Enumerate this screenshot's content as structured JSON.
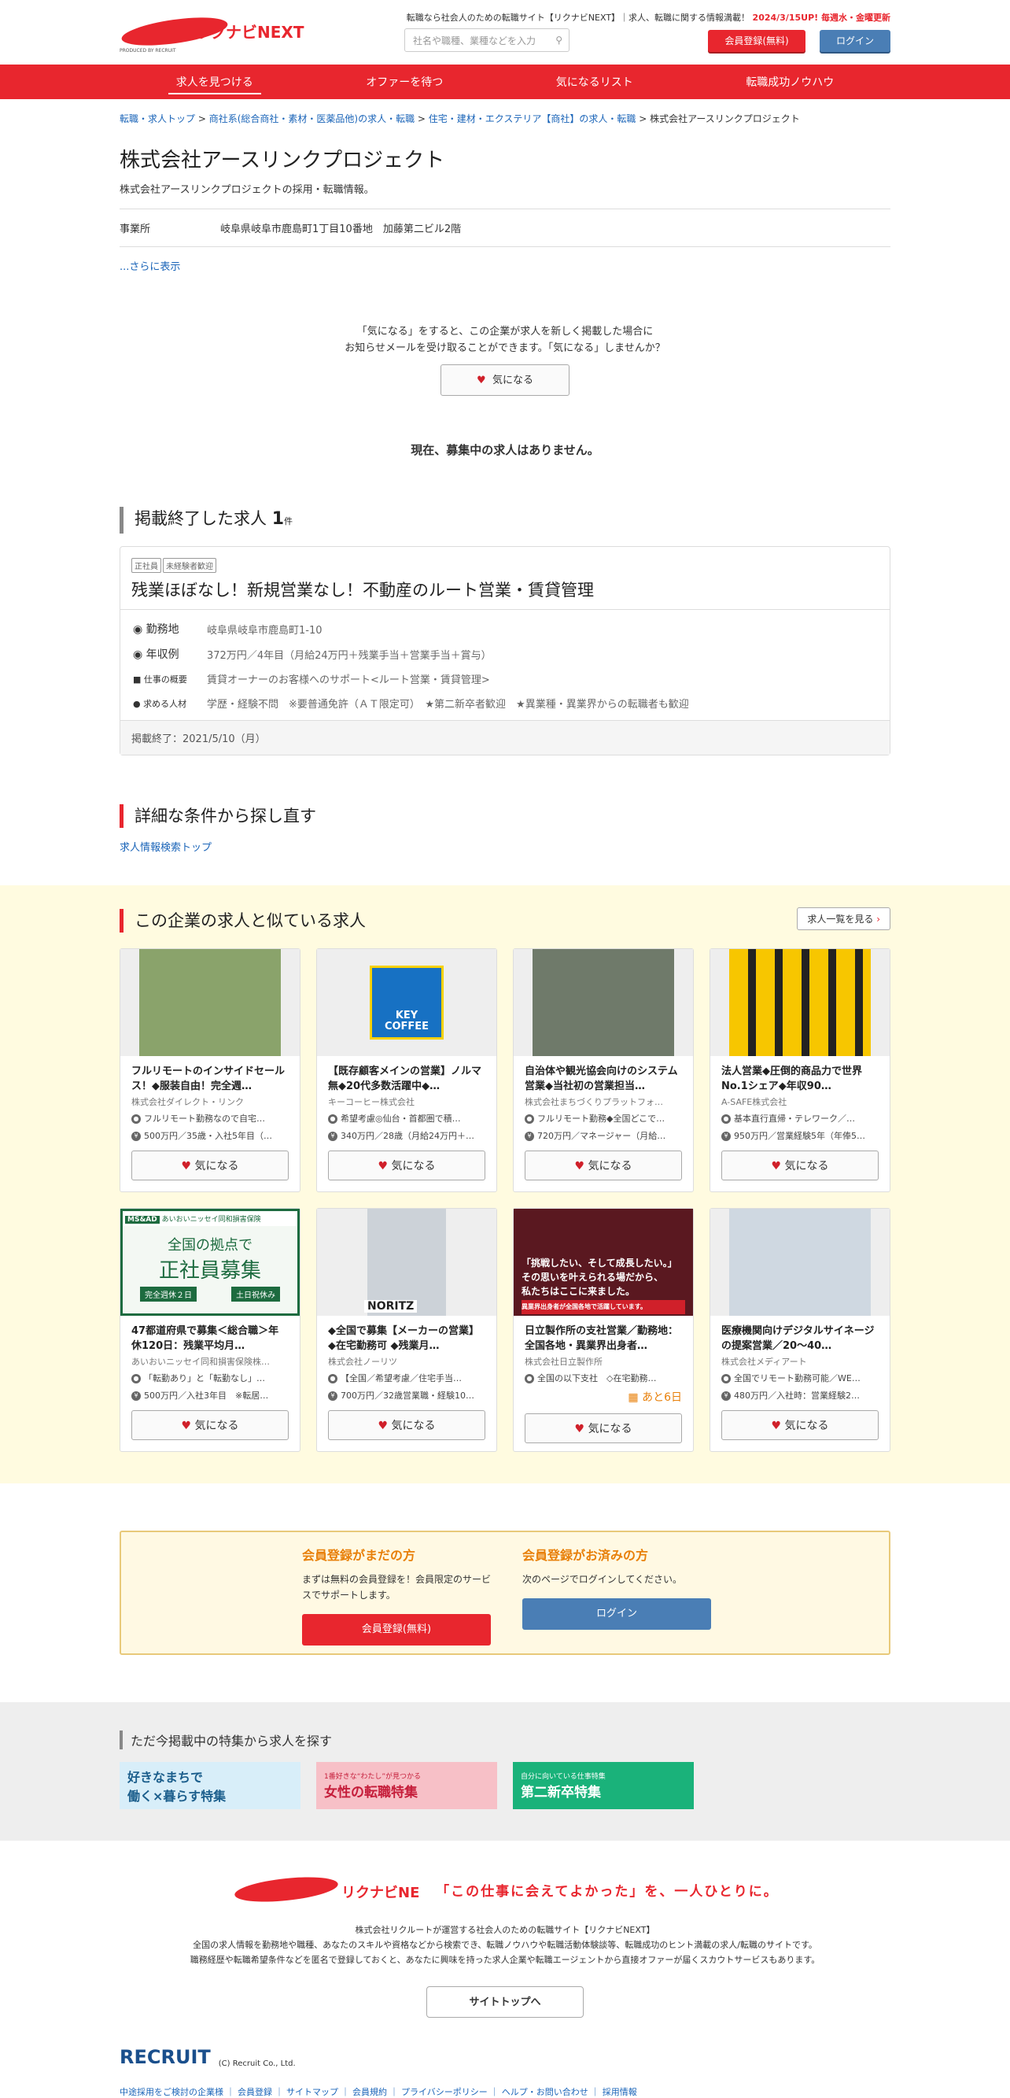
{
  "header": {
    "tagline_pre": "転職なら社会人のための転職サイト【リクナビNEXT】｜求人、転職に関する情報満載！",
    "tagline_hl": "2024/3/15UP! 毎週水・金曜更新",
    "search_placeholder": "社名や職種、業種などを入力",
    "register": "会員登録(無料)",
    "login": "ログイン",
    "logo_text": "リクナビNEXT",
    "produced": "PRODUCED BY RECRUIT"
  },
  "nav": [
    "求人を見つける",
    "オファーを待つ",
    "気になるリスト",
    "転職成功ノウハウ"
  ],
  "breadcrumb": [
    "転職・求人トップ",
    "商社系(総合商社・素材・医薬品他)の求人・転職",
    "住宅・建材・エクステリア【商社】の求人・転職",
    "株式会社アースリンクプロジェクト"
  ],
  "company": {
    "name": "株式会社アースリンクプロジェクト",
    "sub": "株式会社アースリンクプロジェクトの採用・転職情報。",
    "office_label": "事業所",
    "office": "岐阜県岐阜市鹿島町1丁目10番地　加藤第二ビル2階",
    "more": "...さらに表示"
  },
  "kininaru": {
    "l1": "「気になる」をすると、この企業が求人を新しく掲載した場合に",
    "l2": "お知らせメールを受け取ることができます。「気になる」しませんか？",
    "btn": "気になる"
  },
  "no_jobs": "現在、募集中の求人はありません。",
  "ended": {
    "heading": "掲載終了した求人",
    "count": "1",
    "unit": "件",
    "tags": [
      "正社員",
      "未経験者歓迎"
    ],
    "title": "残業ほぼなし！新規営業なし！不動産のルート営業・賃貸管理",
    "rows": [
      {
        "k": "勤務地",
        "v": "岐阜県岐阜市鹿島町1-10"
      },
      {
        "k": "年収例",
        "v": "372万円／4年目（月給24万円＋残業手当＋営業手当＋賞与）"
      },
      {
        "k": "仕事の概要",
        "v": "賃貸オーナーのお客様へのサポート<ルート営業・賃貸管理>"
      },
      {
        "k": "求める人材",
        "v": "学歴・経験不問　※要普通免許（ＡＴ限定可）　★第二新卒者歓迎　★異業種・異業界からの転職者も歓迎"
      }
    ],
    "end": "掲載終了：2021/5/10（月）"
  },
  "search_again": {
    "heading": "詳細な条件から探し直す",
    "link": "求人情報検索トップ"
  },
  "similar": {
    "heading": "この企業の求人と似ている求人",
    "list_btn": "求人一覧を見る",
    "btn": "気になる",
    "cards": [
      {
        "title": "フルリモートのインサイドセールス！◆服装自由！完全週…",
        "company": "株式会社ダイレクト・リンク",
        "r1": "フルリモート勤務なので自宅…",
        "r2": "500万円／35歳・入社5年目（…"
      },
      {
        "title": "【既存顧客メインの営業】ノルマ無◆20代多数活躍中◆…",
        "company": "キーコーヒー株式会社",
        "r1": "希望考慮◎仙台・首都圏で積…",
        "r2": "340万円／28歳（月給24万円＋…"
      },
      {
        "title": "自治体や観光協会向けのシステム営業◆当社初の営業担当…",
        "company": "株式会社まちづくりプラットフォ…",
        "r1": "フルリモート勤務◆全国どこで…",
        "r2": "720万円／マネージャー（月給…"
      },
      {
        "title": "法人営業◆圧倒的商品力で世界No.1シェア◆年収90…",
        "company": "A-SAFE株式会社",
        "r1": "基本直行直帰・テレワーク／…",
        "r2": "950万円／営業経験5年（年俸5…"
      },
      {
        "title": "47都道府県で募集＜総合職＞年休120日：残業平均月…",
        "company": "あいおいニッセイ同和損害保険株…",
        "r1": "「転勤あり」と「転勤なし」…",
        "r2": "500万円／入社3年目　※転居…"
      },
      {
        "title": "◆全国で募集【メーカーの営業】◆在宅勤務可 ◆残業月…",
        "company": "株式会社ノーリツ",
        "r1": "【全国／希望考慮／住宅手当…",
        "r2": "700万円／32歳営業職・経験10…"
      },
      {
        "title": "日立製作所の支社営業／勤務地：全国各地・異業界出身者…",
        "company": "株式会社日立製作所",
        "r1": "全国の以下支社　◇在宅勤務…",
        "r2": "",
        "badge": "あと6日"
      },
      {
        "title": "医療機関向けデジタルサイネージの提案営業／20～40…",
        "company": "株式会社メディアート",
        "r1": "全国でリモート勤務可能／WE…",
        "r2": "480万円／入社時：営業経験2…"
      }
    ]
  },
  "img_text": {
    "key": "KEY",
    "coffee": "COFFEE",
    "ms": "MS&AD",
    "aioi": "あいおいニッセイ同和損害保険",
    "aioi1": "全国の拠点で",
    "aioi2": "正社員募集",
    "aioi3": "完全週休２日",
    "aioi4": "土日祝休み",
    "noritz": "NORITZ",
    "hitachi1": "「挑戦したい、そして成長したい。」",
    "hitachi2": "その思いを叶えられる場だから、",
    "hitachi3": "私たちはここに来ました。",
    "hitachi4": "異業界出身者が全国各地で活躍しています。"
  },
  "member": {
    "h1": "会員登録がまだの方",
    "p1": "まずは無料の会員登録を！会員限定のサービスでサポートします。",
    "b1": "会員登録(無料)",
    "h2": "会員登録がお済みの方",
    "p2": "次のページでログインしてください。",
    "b2": "ログイン"
  },
  "features": {
    "heading": "ただ今掲載中の特集から求人を探す",
    "b1a": "好きなまちで",
    "b1b": "働く×暮らす特集",
    "b2s": "1番好きな“わたし”が見つかる",
    "b2": "女性の転職特集",
    "b3s": "自分に向いている仕事特集",
    "b3": "第二新卒特集"
  },
  "footer": {
    "logo": "リクナビNEXT",
    "tag": "「この仕事に会えてよかった」を、一人ひとりに。",
    "d1": "株式会社リクルートが運営する社会人のための転職サイト【リクナビNEXT】",
    "d2": "全国の求人情報を勤務地や職種、あなたのスキルや資格などから検索でき、転職ノウハウや転職活動体験談等、転職成功のヒント満載の求人/転職のサイトです。",
    "d3": "職務経歴や転職希望条件などを匿名で登録しておくと、あなたに興味を持った求人企業や転職エージェントから直接オファーが届くスカウトサービスもあります。",
    "top": "サイトトップへ",
    "recruit": "RECRUIT",
    "copy": "(C) Recruit Co., Ltd.",
    "links": "中途採用をご検討の企業様 ｜ 会員登録 ｜ サイトマップ ｜ 会員規約 ｜ プライバシーポリシー ｜ ヘルプ・お問い合わせ ｜ 採用情報"
  }
}
